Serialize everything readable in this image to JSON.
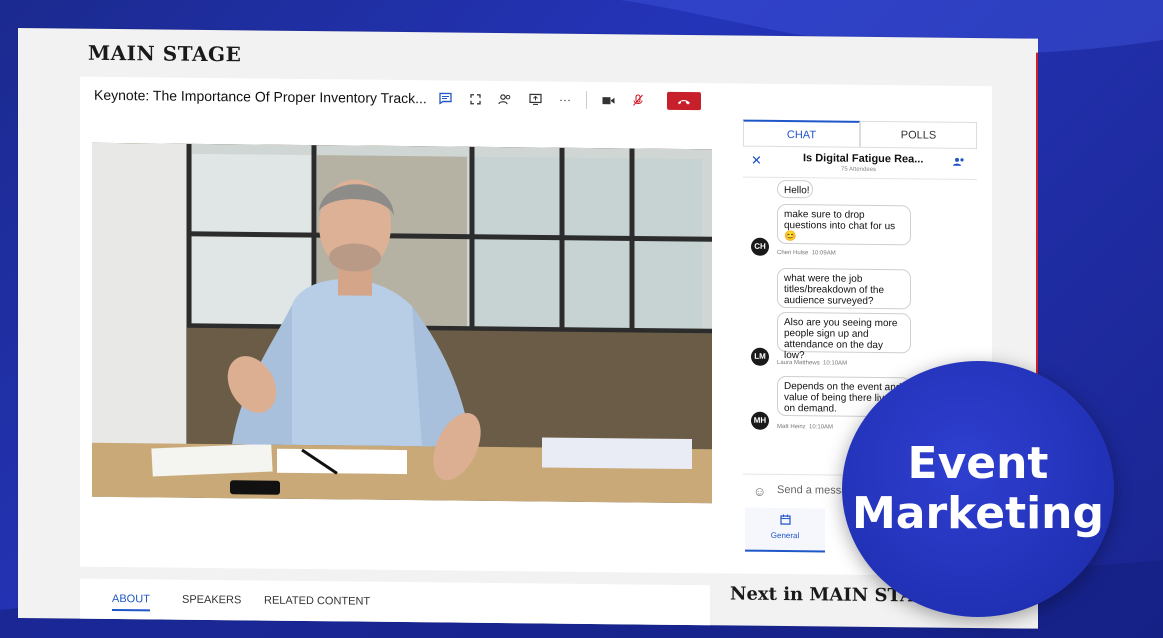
{
  "page": {
    "title": "MAIN STAGE"
  },
  "session": {
    "title": "Keynote: The Importance Of Proper Inventory Track..."
  },
  "sidebar": {
    "tabs": [
      {
        "label": "CHAT"
      },
      {
        "label": "POLLS"
      }
    ],
    "room": {
      "name": "Is Digital Fatigue Rea...",
      "attendees": "75 Attendees"
    },
    "messages": [
      {
        "text": "Hello!"
      },
      {
        "text": "make sure to drop questions into chat for us 😊",
        "author": "Cheri Hulse",
        "time": "10:09AM",
        "initials": "CH"
      },
      {
        "text": "what were the job titles/breakdown of the audience surveyed?"
      },
      {
        "text": "Also are you seeing more people sign up and attendance on the day low?",
        "author": "Laura Matthews",
        "time": "10:10AM",
        "initials": "LM"
      },
      {
        "text": "Depends on the event and value of being there live or on demand.",
        "author": "Matt Heinz",
        "time": "10:10AM",
        "initials": "MH"
      }
    ],
    "send_placeholder": "Send a message...",
    "nav_general": "General"
  },
  "lower": {
    "tabs": [
      {
        "label": "ABOUT"
      },
      {
        "label": "SPEAKERS"
      },
      {
        "label": "RELATED CONTENT"
      }
    ],
    "next_title": "Next in MAIN STAGE"
  },
  "badge": {
    "line1": "Event",
    "line2": "Marketing"
  },
  "icons": {
    "chat": "chat-icon",
    "fullscreen": "fullscreen-icon",
    "people": "people-icon",
    "share": "share-screen-icon",
    "more": "more-icon",
    "camera": "camera-icon",
    "mic": "mic-muted-icon",
    "end": "end-call-icon"
  },
  "colors": {
    "accent": "#1f56c8",
    "danger": "#c8202a",
    "badge": "#2434b8"
  }
}
